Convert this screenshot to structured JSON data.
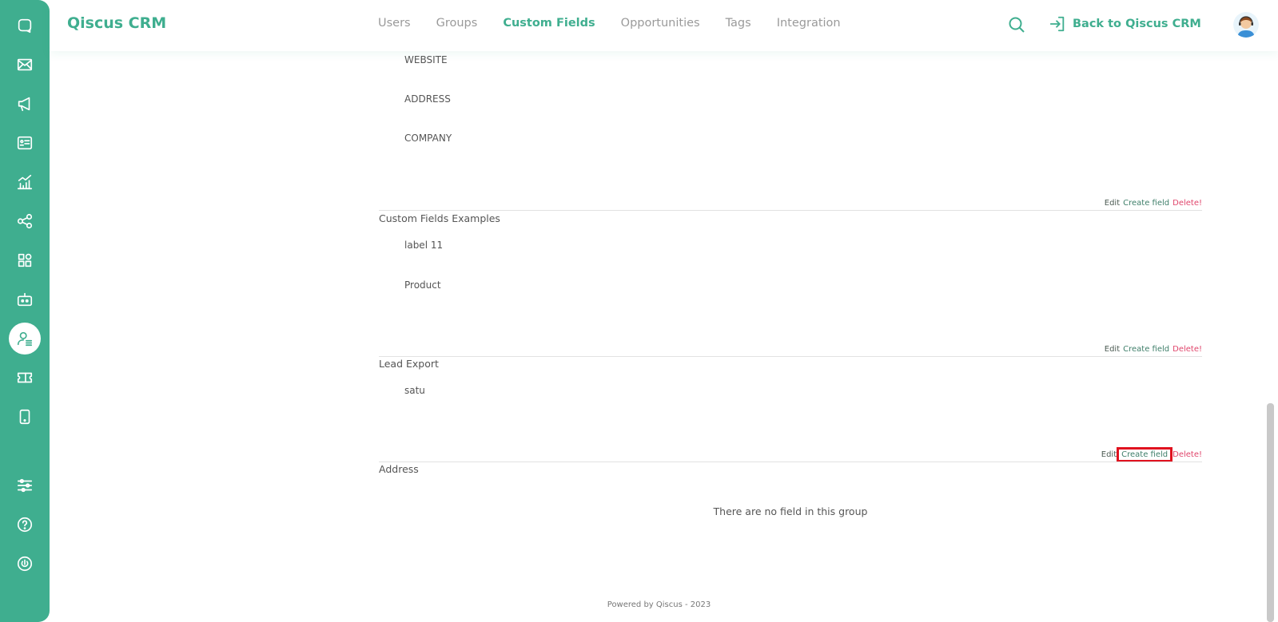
{
  "brand": {
    "name": "Qiscus CRM"
  },
  "nav": {
    "items": [
      {
        "label": "Users"
      },
      {
        "label": "Groups"
      },
      {
        "label": "Custom Fields"
      },
      {
        "label": "Opportunities"
      },
      {
        "label": "Tags"
      },
      {
        "label": "Integration"
      }
    ],
    "active": "Custom Fields"
  },
  "header": {
    "back_label": "Back to Qiscus CRM"
  },
  "groups": {
    "first": {
      "fields": [
        "WEBSITE",
        "ADDRESS",
        "COMPANY"
      ]
    },
    "custom_fields_examples": {
      "title": "Custom Fields Examples",
      "fields": [
        "label 11",
        "Product"
      ]
    },
    "lead_export": {
      "title": "Lead Export",
      "fields": [
        "satu"
      ]
    },
    "address": {
      "title": "Address",
      "empty_message": "There are no field in this group"
    }
  },
  "actions": {
    "edit": "Edit",
    "create": "Create field",
    "delete": "Delete!"
  },
  "footer": {
    "text": "Powered by Qiscus - 2023"
  },
  "colors": {
    "accent": "#3fae8f",
    "delete": "#e0456b",
    "highlight": "#e0121f"
  }
}
